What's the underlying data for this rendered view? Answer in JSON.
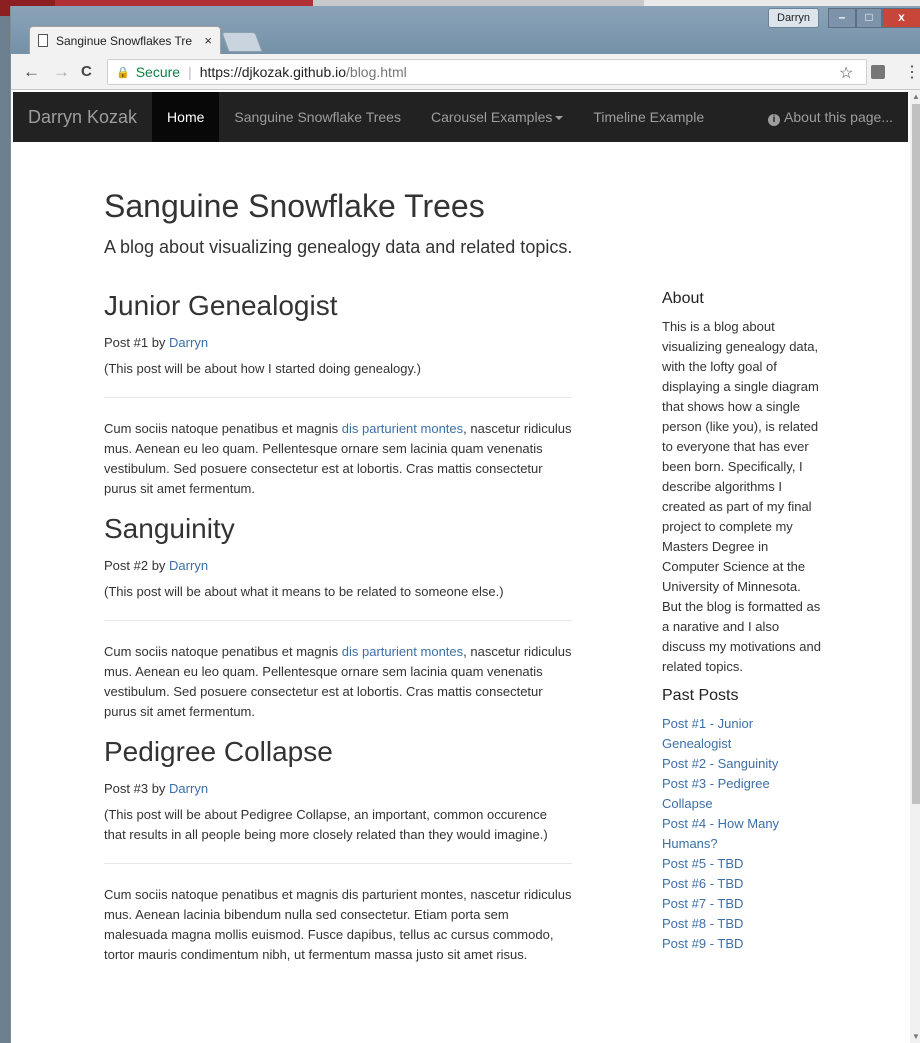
{
  "browser": {
    "tab_title": "Sanginue Snowflakes Tre",
    "tab_close": "×",
    "user_badge": "Darryn",
    "min_glyph": "–",
    "max_glyph": "□",
    "close_glyph": "x",
    "back_glyph": "←",
    "forward_glyph": "→",
    "reload_glyph": "C",
    "lock_glyph": "🔒",
    "secure_label": "Secure",
    "separator": "|",
    "url_host": "https://djkozak.github.io",
    "url_path": "/blog.html",
    "star_glyph": "☆",
    "menu_glyph": "⋮"
  },
  "navbar": {
    "brand": "Darryn Kozak",
    "items": [
      {
        "label": "Home"
      },
      {
        "label": "Sanguine Snowflake Trees"
      },
      {
        "label": "Carousel Examples"
      },
      {
        "label": "Timeline Example"
      }
    ],
    "info_glyph": "i",
    "about_label": "About this page..."
  },
  "header": {
    "title": "Sanguine Snowflake Trees",
    "description": "A blog about visualizing genealogy data and related topics."
  },
  "posts": [
    {
      "title": "Junior Genealogist",
      "meta_prefix": "Post #1 by ",
      "author": "Darryn",
      "note": "(This post will be about how I started doing genealogy.)",
      "body_a": "Cum sociis natoque penatibus et magnis ",
      "body_link": "dis parturient montes",
      "body_b": ", nascetur ridiculus mus. Aenean eu leo quam. Pellentesque ornare sem lacinia quam venenatis vestibulum. Sed posuere consectetur est at lobortis. Cras mattis consectetur purus sit amet fermentum."
    },
    {
      "title": "Sanguinity",
      "meta_prefix": "Post #2 by ",
      "author": "Darryn",
      "note": "(This post will be about what it means to be related to someone else.)",
      "body_a": "Cum sociis natoque penatibus et magnis ",
      "body_link": "dis parturient montes",
      "body_b": ", nascetur ridiculus mus. Aenean eu leo quam. Pellentesque ornare sem lacinia quam venenatis vestibulum. Sed posuere consectetur est at lobortis. Cras mattis consectetur purus sit amet fermentum."
    },
    {
      "title": "Pedigree Collapse",
      "meta_prefix": "Post #3 by ",
      "author": "Darryn",
      "note": "(This post will be about Pedigree Collapse, an important, common occurence that results in all people being more closely related than they would imagine.)",
      "body": "Cum sociis natoque penatibus et magnis dis parturient montes, nascetur ridiculus mus. Aenean lacinia bibendum nulla sed consectetur. Etiam porta sem malesuada magna mollis euismod. Fusce dapibus, tellus ac cursus commodo, tortor mauris condimentum nibh, ut fermentum massa justo sit amet risus."
    }
  ],
  "sidebar": {
    "about_heading": "About",
    "about_text": "This is a blog about visualizing genealogy data, with the lofty goal of displaying a single diagram that shows how a single person (like you), is related to everyone that has ever been born. Specifically, I describe algorithms I created as part of my final project to complete my Masters Degree in Computer Science at the University of Minnesota. But the blog is formatted as a narative and I also discuss my motivations and related topics.",
    "past_heading": "Past Posts",
    "past_posts": [
      "Post #1 - Junior Genealogist",
      "Post #2 - Sanguinity",
      "Post #3 - Pedigree Collapse",
      "Post #4 - How Many Humans?",
      "Post #5 - TBD",
      "Post #6 - TBD",
      "Post #7 - TBD",
      "Post #8 - TBD",
      "Post #9 - TBD"
    ]
  },
  "scrollbar": {
    "up_glyph": "▲",
    "down_glyph": "▼"
  },
  "colors": {
    "navbar_bg": "#222222",
    "link": "#3c6fa7",
    "secure": "#0b8043"
  }
}
